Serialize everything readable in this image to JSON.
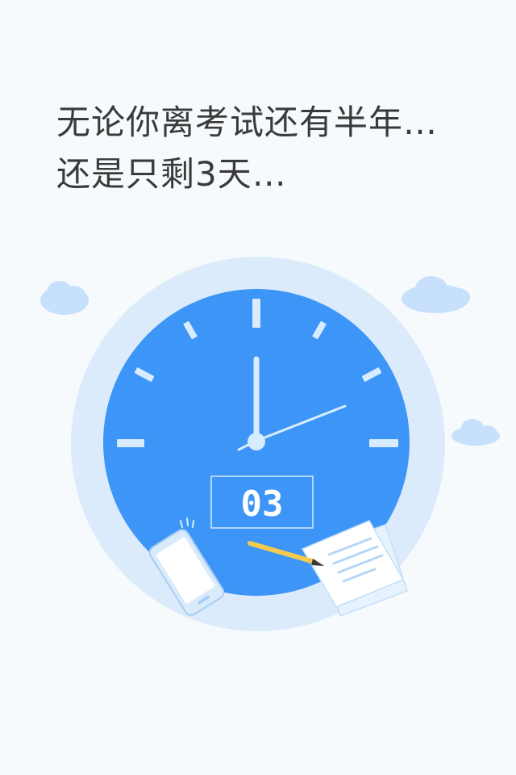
{
  "headline": {
    "line1": "无论你离考试还有半年…",
    "line2": "还是只剩3天…"
  },
  "countdown": {
    "value": "03"
  },
  "colors": {
    "background": "#f6fafd",
    "clock_face": "#3d95f7",
    "clock_halo": "#dcebfb",
    "tick": "#d8ecff",
    "cloud": "#c7e0fb",
    "text": "#3a3a3a",
    "pencil": "#f4cb4d"
  },
  "icons": {
    "clock": "clock-icon",
    "cloud": "cloud-icon",
    "phone": "phone-icon",
    "papers": "document-icon",
    "pencil": "pencil-icon"
  }
}
